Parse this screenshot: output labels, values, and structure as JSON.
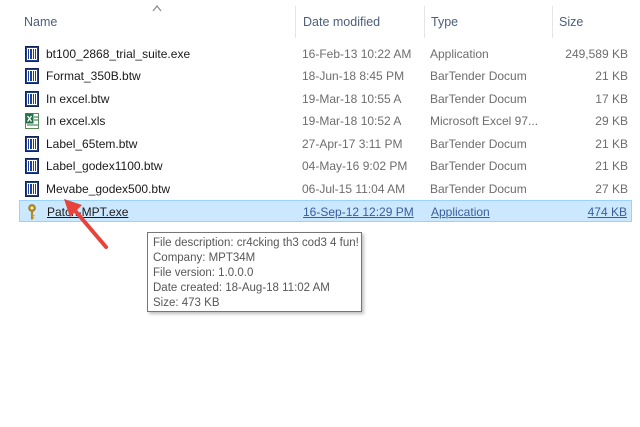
{
  "columns": {
    "name": "Name",
    "date": "Date modified",
    "type": "Type",
    "size": "Size"
  },
  "files": [
    {
      "name": "bt100_2868_trial_suite.exe",
      "date": "16-Feb-13 10:22 AM",
      "type": "Application",
      "size": "249,589 KB",
      "icon": "bartender-icon"
    },
    {
      "name": "Format_350B.btw",
      "date": "18-Jun-18 8:45 PM",
      "type": "BarTender Docum",
      "size": "21 KB",
      "icon": "bartender-icon"
    },
    {
      "name": "In excel.btw",
      "date": "19-Mar-18 10:55 A",
      "type": "BarTender Docum",
      "size": "17 KB",
      "icon": "bartender-icon"
    },
    {
      "name": "In excel.xls",
      "date": "19-Mar-18 10:52 A",
      "type": "Microsoft Excel 97...",
      "size": "29 KB",
      "icon": "excel-icon"
    },
    {
      "name": "Label_65tem.btw",
      "date": "27-Apr-17 3:11 PM",
      "type": "BarTender Docum",
      "size": "21 KB",
      "icon": "bartender-icon"
    },
    {
      "name": "Label_godex1100.btw",
      "date": "04-May-16 9:02 PM",
      "type": "BarTender Docum",
      "size": "21 KB",
      "icon": "bartender-icon"
    },
    {
      "name": "Mevabe_godex500.btw",
      "date": "06-Jul-15 11:04 AM",
      "type": "BarTender Docum",
      "size": "27 KB",
      "icon": "bartender-icon"
    },
    {
      "name": "Patch-MPT.exe",
      "date": "16-Sep-12 12:29 PM",
      "type": "Application",
      "size": "474 KB",
      "icon": "key-icon",
      "selected": true
    }
  ],
  "tooltip": {
    "description": "File description: cr4cking th3 cod3 4 fun!",
    "company": "Company: MPT34M",
    "version": "File version: 1.0.0.0",
    "created": "Date created: 18-Aug-18 11:02 AM",
    "size": "Size: 473 KB"
  },
  "colors": {
    "selection_bg": "#cce8ff",
    "selection_border": "#99d1ff",
    "arrow": "#e8433a"
  }
}
